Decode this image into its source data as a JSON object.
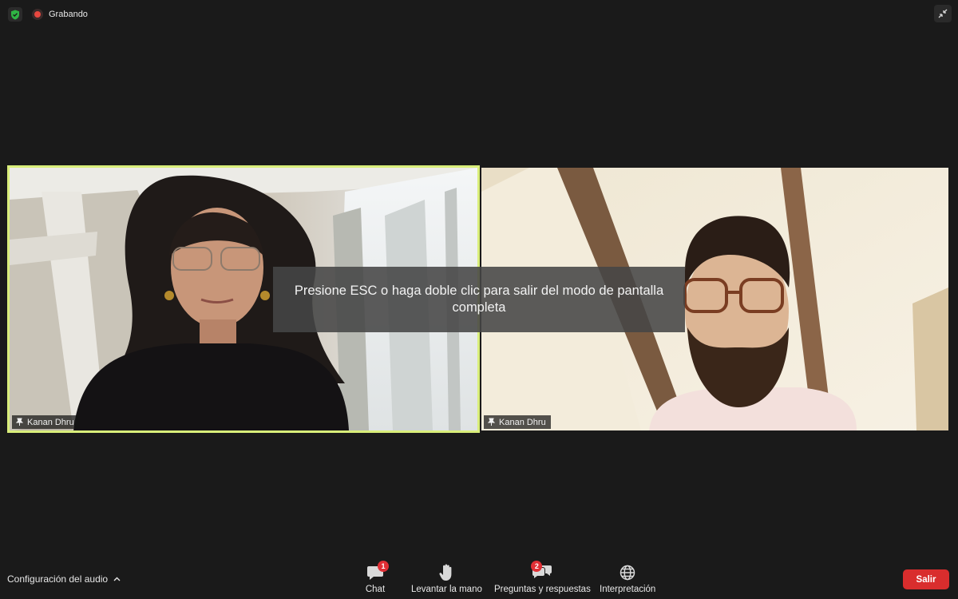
{
  "topbar": {
    "recording_label": "Grabando",
    "shield_icon": "shield-check-icon",
    "exit_fullscreen_icon": "exit-fullscreen-icon",
    "colors": {
      "shield": "#2fb344",
      "recording": "#e8473f"
    }
  },
  "videos": [
    {
      "participant": "Kanan Dhru",
      "active_speaker": true,
      "icon": "pin-icon"
    },
    {
      "participant": "Kanan Dhru",
      "active_speaker": false,
      "icon": "pin-icon"
    }
  ],
  "toast": {
    "message": "Presione ESC o haga doble clic para salir del modo de pantalla completa"
  },
  "toolbar": {
    "audio_settings_label": "Configuración del audio",
    "chat_label": "Chat",
    "chat_badge": "1",
    "raise_hand_label": "Levantar la mano",
    "qa_label": "Preguntas y respuestas",
    "qa_badge": "2",
    "interpretation_label": "Interpretación",
    "leave_label": "Salir",
    "colors": {
      "leave": "#d92d2d",
      "badge": "#e02f35",
      "active_border": "#d9ee7a"
    }
  }
}
